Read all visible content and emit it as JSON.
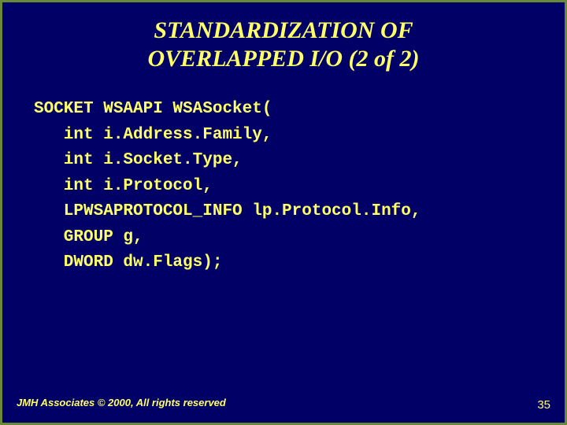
{
  "title_line1": "STANDARDIZATION OF",
  "title_line2": "OVERLAPPED I/O (2 of 2)",
  "code": {
    "l1": "SOCKET WSAAPI WSASocket(",
    "l2": "   int i.Address.Family,",
    "l3": "   int i.Socket.Type,",
    "l4": "   int i.Protocol,",
    "l5": "   LPWSAPROTOCOL_INFO lp.Protocol.Info,",
    "l6": "   GROUP g,",
    "l7": "   DWORD dw.Flags);"
  },
  "footer_left": "JMH Associates © 2000, All rights reserved",
  "footer_right": "35"
}
